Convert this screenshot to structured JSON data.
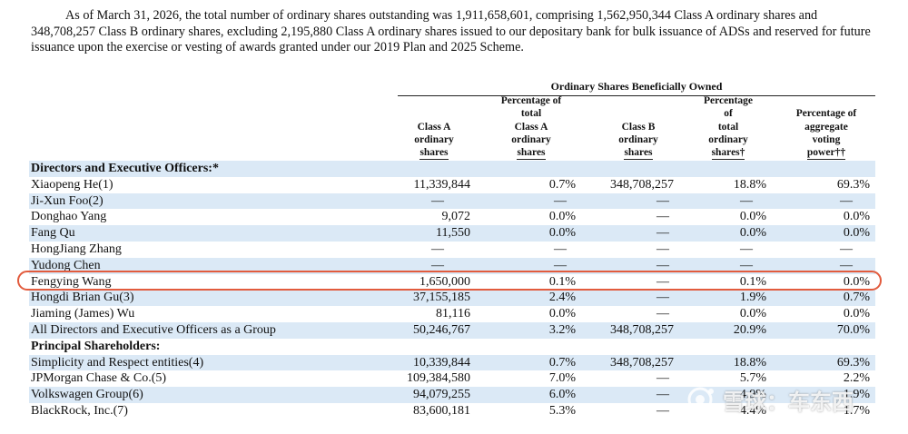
{
  "intro": "As of March 31, 2026, the total number of ordinary shares outstanding was 1,911,658,601, comprising 1,562,950,344 Class A ordinary shares and 348,708,257 Class B ordinary shares, excluding 2,195,880 Class A ordinary shares issued to our depositary bank for bulk issuance of ADSs and reserved for future issuance upon the exercise or vesting of awards granted under our 2019 Plan and 2025 Scheme.",
  "table": {
    "group_header": "Ordinary Shares Beneficially Owned",
    "columns": [
      {
        "lines": [
          "",
          "",
          "Class A",
          "ordinary",
          "shares"
        ]
      },
      {
        "lines": [
          "Percentage of",
          "total",
          "Class A",
          "ordinary",
          "shares"
        ]
      },
      {
        "lines": [
          "",
          "",
          "Class B",
          "ordinary",
          "shares"
        ]
      },
      {
        "lines": [
          "Percentage",
          "of",
          "total",
          "ordinary",
          "shares†"
        ]
      },
      {
        "lines": [
          "",
          "Percentage of",
          "aggregate",
          "voting",
          "power††"
        ]
      }
    ],
    "rows": [
      {
        "section": true,
        "name": "Directors and Executive Officers:*",
        "cells": [
          "",
          "",
          "",
          "",
          ""
        ]
      },
      {
        "name": "Xiaopeng He(1)",
        "cells": [
          "11,339,844",
          "0.7%",
          "348,708,257",
          "18.8%",
          "69.3%"
        ]
      },
      {
        "name": "Ji-Xun Foo(2)",
        "cells": [
          "—",
          "—",
          "—",
          "—",
          "—"
        ]
      },
      {
        "name": "Donghao Yang",
        "cells": [
          "9,072",
          "0.0%",
          "—",
          "0.0%",
          "0.0%"
        ]
      },
      {
        "name": "Fang Qu",
        "cells": [
          "11,550",
          "0.0%",
          "—",
          "0.0%",
          "0.0%"
        ]
      },
      {
        "name": "HongJiang Zhang",
        "cells": [
          "—",
          "—",
          "—",
          "—",
          "—"
        ]
      },
      {
        "name": "Yudong Chen",
        "cells": [
          "—",
          "—",
          "—",
          "—",
          "—"
        ]
      },
      {
        "name": "Fengying Wang",
        "cells": [
          "1,650,000",
          "0.1%",
          "—",
          "0.1%",
          "0.0%"
        ]
      },
      {
        "name": "Hongdi Brian Gu(3)",
        "cells": [
          "37,155,185",
          "2.4%",
          "—",
          "1.9%",
          "0.7%"
        ]
      },
      {
        "name": "Jiaming (James) Wu",
        "cells": [
          "81,116",
          "0.0%",
          "—",
          "0.0%",
          "0.0%"
        ]
      },
      {
        "name": "All Directors and Executive Officers as a Group",
        "cells": [
          "50,246,767",
          "3.2%",
          "348,708,257",
          "20.9%",
          "70.0%"
        ]
      },
      {
        "section": true,
        "name": "Principal Shareholders:",
        "cells": [
          "",
          "",
          "",
          "",
          ""
        ]
      },
      {
        "name": "Simplicity and Respect entities(4)",
        "cells": [
          "10,339,844",
          "0.7%",
          "348,708,257",
          "18.8%",
          "69.3%"
        ]
      },
      {
        "name": "JPMorgan Chase & Co.(5)",
        "cells": [
          "109,384,580",
          "7.0%",
          "—",
          "5.7%",
          "2.2%"
        ]
      },
      {
        "name": "Volkswagen Group(6)",
        "cells": [
          "94,079,255",
          "6.0%",
          "—",
          "4.9%",
          "1.9%"
        ]
      },
      {
        "name": "BlackRock, Inc.(7)",
        "cells": [
          "83,600,181",
          "5.3%",
          "—",
          "4.4%",
          "1.7%"
        ]
      }
    ]
  },
  "watermark": {
    "text": "雪球：车东西",
    "icon": "snowball-logo-icon"
  },
  "highlight_color": "#e25b3d",
  "row_shade_color": "#dbe9f6"
}
